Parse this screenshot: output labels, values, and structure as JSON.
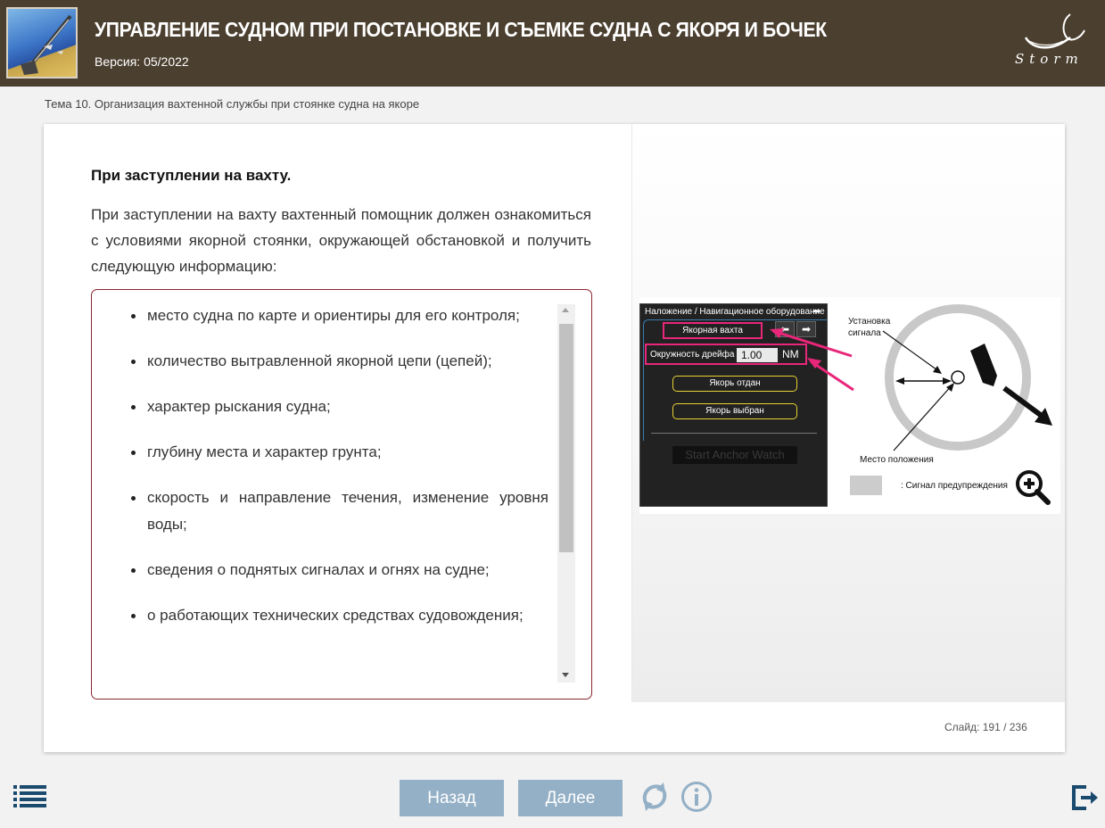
{
  "header": {
    "title": "УПРАВЛЕНИЕ СУДНОМ ПРИ ПОСТАНОВКЕ И СЪЕМКЕ СУДНА С ЯКОРЯ И БОЧЕК",
    "version": "Версия: 05/2022",
    "brand": "Storm"
  },
  "topic": "Тема 10. Организация вахтенной службы при стоянке судна на якоре",
  "content": {
    "heading": "При заступлении на вахту.",
    "intro": "При заступлении на вахту вахтенный помощник должен ознакомиться с условиями якорной стоянки, окружающей обстановкой и получить следующую информацию:",
    "items": [
      "место судна по карте и ориентиры для его контроля;",
      "количество вытравленной якорной цепи (цепей);",
      "характер рыскания судна;",
      "глубину места и характер грунта;",
      "скорость и направление течения, изменение уровня воды;",
      "сведения о поднятых сигналах и огнях на судне;",
      "о работающих технических средствах судовождения;"
    ]
  },
  "figure": {
    "panel_header": "Наложение / Навигационное оборудование",
    "anchor_watch_tab": "Якорная вахта",
    "drift_label": "Окружность дрейфа",
    "drift_value": "1.00",
    "drift_unit": "NM",
    "anchor_dropped_btn": "Якорь отдан",
    "anchor_raised_btn": "Якорь выбран",
    "start_btn": "Start Anchor Watch",
    "label_signal_setup": "Установка\nсигнала",
    "label_position": "Место положения",
    "label_warning": ": Сигнал предупреждения",
    "pink_color": "#e8267a",
    "yellow_color": "#e8d233"
  },
  "footer": {
    "slide_label": "Слайд:",
    "slide_value": "191 / 236",
    "back_label": "Назад",
    "next_label": "Далее"
  },
  "colors": {
    "header_bg": "#4b3f2f",
    "button_bg": "#94b0c6",
    "list_border": "#8a2530",
    "icon_color": "#1a4a6e"
  }
}
